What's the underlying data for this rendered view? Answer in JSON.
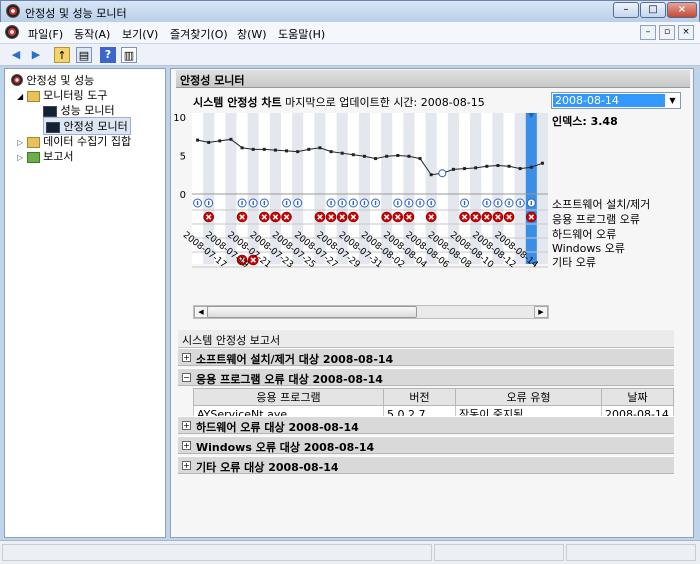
{
  "window": {
    "title": "안정성 및 성능 모니터",
    "min": "–",
    "max": "□",
    "close": "×"
  },
  "menu": [
    "파일(F)",
    "동작(A)",
    "보기(V)",
    "즐겨찾기(O)",
    "창(W)",
    "도움말(H)"
  ],
  "tree": {
    "root": "안정성 및 성능",
    "tools": "모니터링 도구",
    "perf": "성능 모니터",
    "reliability": "안정성 모니터",
    "collector": "데이터 수집기 집합",
    "reports": "보고서"
  },
  "panel_header": "안정성 모니터",
  "chart_header": {
    "title": "시스템 안정성 차트",
    "updated": "마지막으로 업데이트한 시간: 2008-08-15"
  },
  "date_select": {
    "value": "2008-08-14"
  },
  "index_label": "인덱스: 3.48",
  "row_labels": [
    "소프트웨어 설치/제거",
    "응용 프로그램 오류",
    "하드웨어 오류",
    "Windows 오류",
    "기타 오류"
  ],
  "chart_data": {
    "type": "line",
    "ylim": [
      0,
      10
    ],
    "yticks": [
      "10",
      "5",
      "0"
    ],
    "x_labels": [
      "2008-07-17",
      "2008-07-19",
      "2008-07-21",
      "2008-07-23",
      "2008-07-25",
      "2008-07-27",
      "2008-07-29",
      "2008-07-31",
      "2008-08-02",
      "2008-08-04",
      "2008-08-06",
      "2008-08-08",
      "2008-08-10",
      "2008-08-12",
      "2008-08-14"
    ],
    "x": [
      "2008-07-15",
      "2008-07-16",
      "2008-07-17",
      "2008-07-18",
      "2008-07-19",
      "2008-07-20",
      "2008-07-21",
      "2008-07-22",
      "2008-07-23",
      "2008-07-24",
      "2008-07-25",
      "2008-07-26",
      "2008-07-27",
      "2008-07-28",
      "2008-07-29",
      "2008-07-30",
      "2008-07-31",
      "2008-08-01",
      "2008-08-02",
      "2008-08-03",
      "2008-08-04",
      "2008-08-05",
      "2008-08-06",
      "2008-08-07",
      "2008-08-08",
      "2008-08-09",
      "2008-08-10",
      "2008-08-11",
      "2008-08-12",
      "2008-08-13",
      "2008-08-14",
      "2008-08-15"
    ],
    "values": [
      7.0,
      6.7,
      6.9,
      7.1,
      6.0,
      5.8,
      5.8,
      5.7,
      5.6,
      5.5,
      5.8,
      6.0,
      5.5,
      5.3,
      5.1,
      4.9,
      4.6,
      4.9,
      5.0,
      4.9,
      4.6,
      2.5,
      2.7,
      3.2,
      3.3,
      3.4,
      3.6,
      3.7,
      3.6,
      3.3,
      3.48,
      4.0
    ],
    "warning_day_index": [
      22
    ],
    "selected_day_index": 30,
    "install_days": [
      0,
      1,
      4,
      5,
      6,
      8,
      9,
      12,
      13,
      14,
      15,
      16,
      18,
      19,
      20,
      21,
      24,
      26,
      27,
      28,
      29,
      30
    ],
    "app_error_days": [
      1,
      4,
      6,
      7,
      8,
      11,
      12,
      13,
      14,
      17,
      18,
      19,
      21,
      24,
      25,
      26,
      27,
      28,
      30
    ],
    "misc_error_days": [
      4,
      5
    ]
  },
  "report": {
    "header": "시스템 안정성 보고서",
    "sections": [
      {
        "sign": "+",
        "title": "소프트웨어 설치/제거 대상 2008-08-14"
      },
      {
        "sign": "−",
        "title": "응용 프로그램 오류 대상 2008-08-14"
      },
      {
        "sign": "+",
        "title": "하드웨어 오류 대상 2008-08-14"
      },
      {
        "sign": "+",
        "title": "Windows 오류 대상 2008-08-14"
      },
      {
        "sign": "+",
        "title": "기타 오류 대상 2008-08-14"
      }
    ],
    "columns": [
      "응용 프로그램",
      "버전",
      "오류 유형",
      "날짜"
    ],
    "rows": [
      [
        "AYServiceNt.aye",
        "5.0.2.7",
        "작동이 중지됨",
        "2008-08-14"
      ]
    ]
  },
  "colors": {
    "accent": "#3399ff",
    "error": "#cc0000",
    "info": "#2d63c8"
  }
}
